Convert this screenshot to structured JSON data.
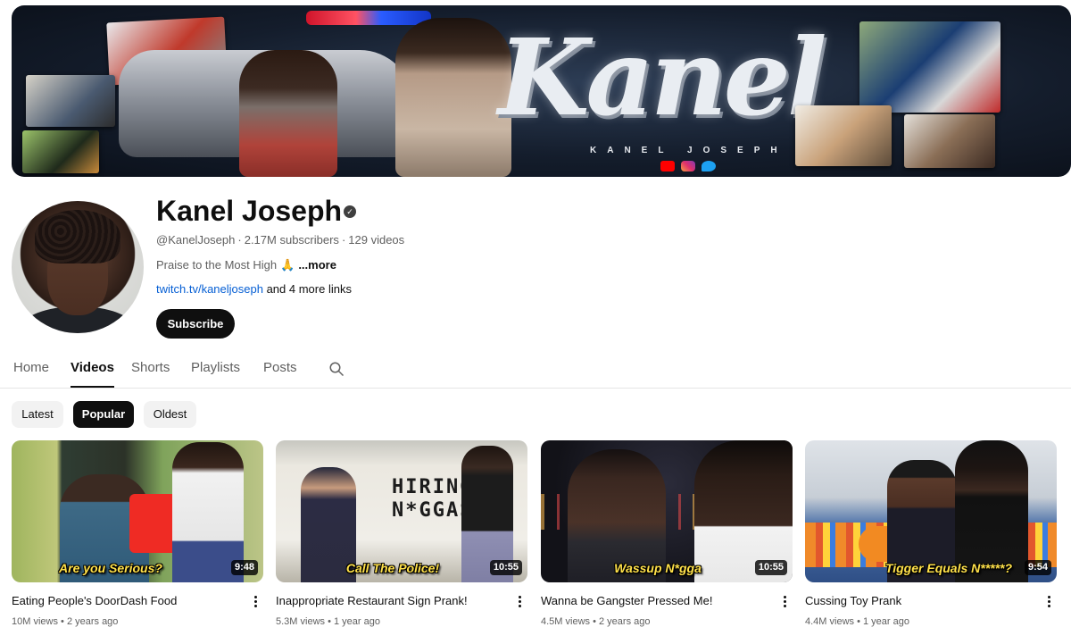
{
  "banner": {
    "logo_text": "Kanel",
    "logo_subtext": "KANEL JOSEPH",
    "social_icons": [
      "youtube-icon",
      "instagram-icon",
      "twitter-icon"
    ]
  },
  "channel": {
    "name": "Kanel Joseph",
    "handle": "@KanelJoseph",
    "subscribers": "2.17M subscribers",
    "video_count": "129 videos",
    "description": "Praise to the Most High",
    "description_emoji": "🙏",
    "more_label": "...more",
    "link": "twitch.tv/kaneljoseph",
    "more_links": "and 4 more links",
    "subscribe_label": "Subscribe"
  },
  "tabs": [
    {
      "label": "Home",
      "active": false
    },
    {
      "label": "Videos",
      "active": true
    },
    {
      "label": "Shorts",
      "active": false
    },
    {
      "label": "Playlists",
      "active": false
    },
    {
      "label": "Posts",
      "active": false
    }
  ],
  "chips": [
    {
      "label": "Latest",
      "active": false
    },
    {
      "label": "Popular",
      "active": true
    },
    {
      "label": "Oldest",
      "active": false
    }
  ],
  "videos": [
    {
      "title": "Eating People's DoorDash Food",
      "views": "10M views",
      "age": "2 years ago",
      "duration": "9:48",
      "thumb_caption": "Are you Serious?"
    },
    {
      "title": "Inappropriate Restaurant Sign Prank!",
      "views": "5.3M views",
      "age": "1 year ago",
      "duration": "10:55",
      "thumb_caption": "Call The Police!",
      "thumb_sign": "HIRING N*GGAS"
    },
    {
      "title": "Wanna be Gangster Pressed Me!",
      "views": "4.5M views",
      "age": "2 years ago",
      "duration": "10:55",
      "thumb_caption": "Wassup N*gga"
    },
    {
      "title": "Cussing Toy Prank",
      "views": "4.4M views",
      "age": "1 year ago",
      "duration": "9:54",
      "thumb_caption": "Tigger Equals N*****?"
    }
  ],
  "colors": {
    "accent_dark": "#0f0f0f",
    "link_blue": "#065fd4",
    "secondary_text": "#606060",
    "chip_bg": "#f2f2f2"
  }
}
